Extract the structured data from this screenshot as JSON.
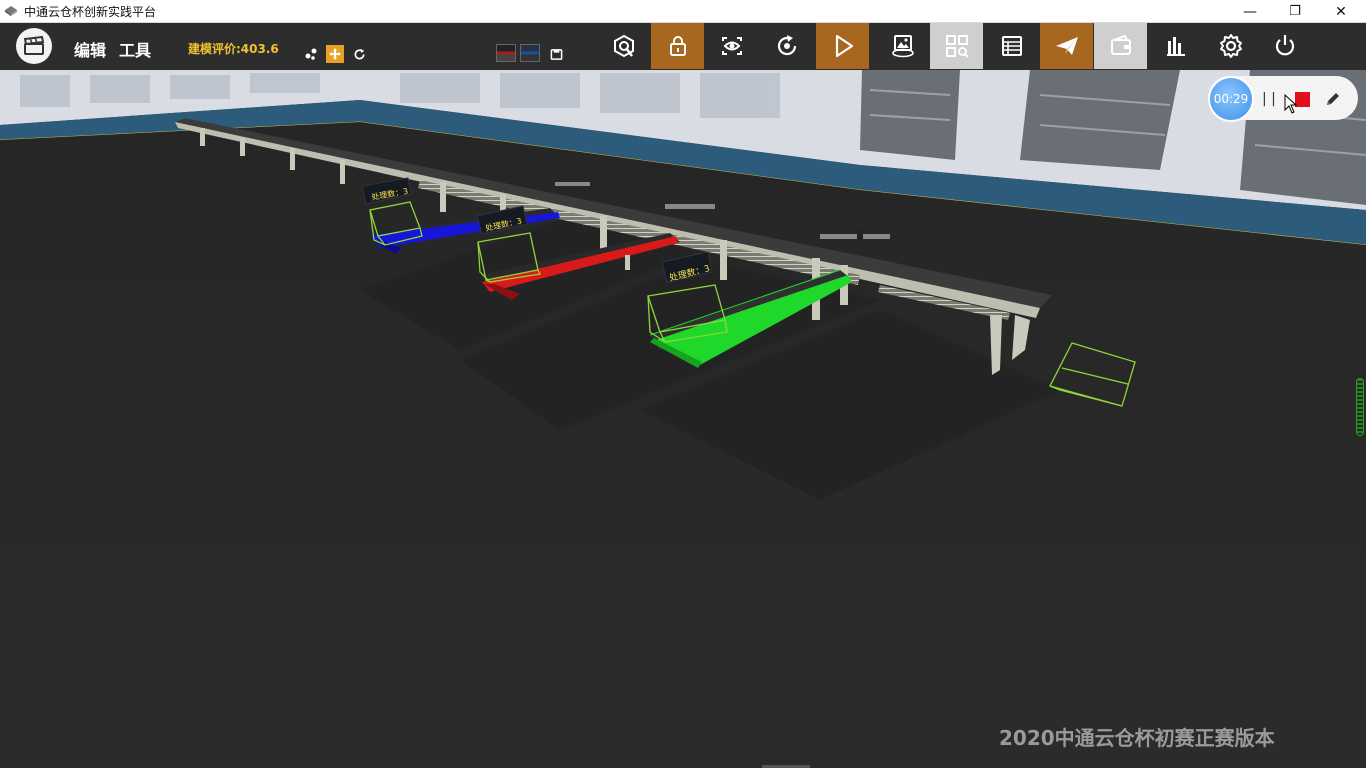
{
  "window": {
    "title": "中通云仓杯创新实践平台",
    "controls": {
      "minimize": "—",
      "restore": "❐",
      "close": "✕"
    }
  },
  "toolbar": {
    "menu": [
      {
        "label": "编辑"
      },
      {
        "label": "工具"
      }
    ],
    "score_label": "建模评价:403.6",
    "icons": [
      "target-icon",
      "lock-icon",
      "eye-icon",
      "rotate-icon",
      "play-icon",
      "image-360-icon",
      "grid-search-icon",
      "list-icon",
      "send-icon",
      "wallet-icon",
      "bar-chart-icon",
      "gear-icon",
      "power-icon"
    ],
    "accent_orange": "#a8671f",
    "score_color": "#f2c12e"
  },
  "recording": {
    "timer": "00:29",
    "pause_label": "| |"
  },
  "scene": {
    "counters": [
      {
        "label": "处理数：3"
      },
      {
        "label": "处理数：3"
      },
      {
        "label": "处理数：3"
      }
    ],
    "belt_colors": {
      "blue": "#1616d6",
      "red": "#d81a1a",
      "green": "#1fd82a"
    }
  },
  "watermark": "2020中通云仓杯初赛正赛版本"
}
